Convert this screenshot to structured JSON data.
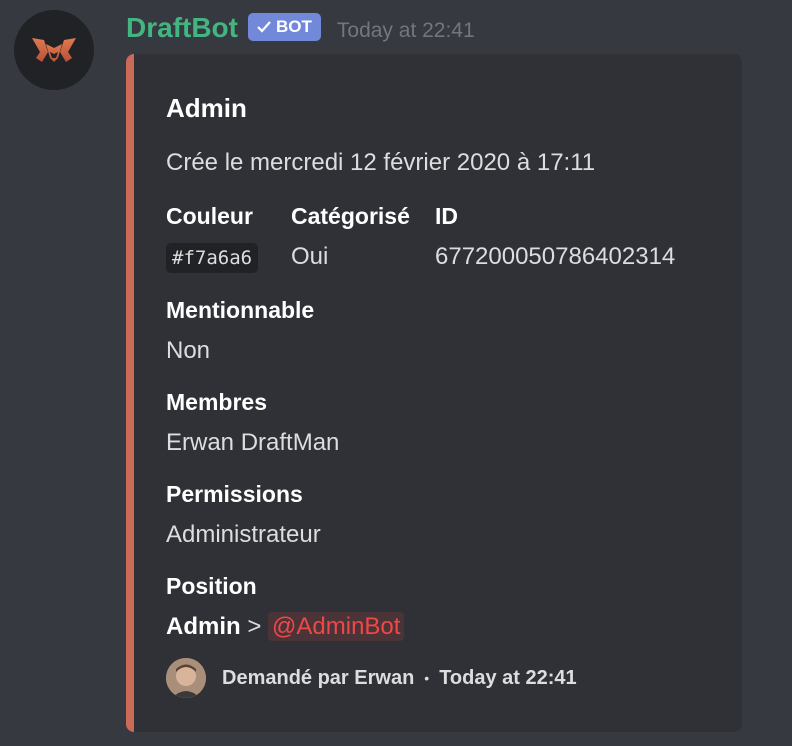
{
  "message": {
    "author": "DraftBot",
    "bot_tag": "BOT",
    "timestamp": "Today at 22:41"
  },
  "embed": {
    "color": "#c96b56",
    "title": "Admin",
    "description": "Crée le mercredi 12 février 2020 à 17:11",
    "fields": {
      "couleur": {
        "name": "Couleur",
        "value": "#f7a6a6"
      },
      "categorise": {
        "name": "Catégorisé",
        "value": "Oui"
      },
      "id": {
        "name": "ID",
        "value": "677200050786402314"
      },
      "mentionnable": {
        "name": "Mentionnable",
        "value": "Non"
      },
      "membres": {
        "name": "Membres",
        "value": "Erwan DraftMan"
      },
      "permissions": {
        "name": "Permissions",
        "value": "Administrateur"
      },
      "position": {
        "name": "Position",
        "role": "Admin",
        "separator": ">",
        "mention": "@AdminBot"
      }
    },
    "footer": {
      "text": "Demandé par Erwan",
      "separator": "•",
      "timestamp": "Today at 22:41"
    }
  },
  "colors": {
    "username": "#43b581",
    "bot_tag": "#7289da",
    "mention": "#f04747",
    "background": "#36393f",
    "embed_background": "#2f3136"
  }
}
